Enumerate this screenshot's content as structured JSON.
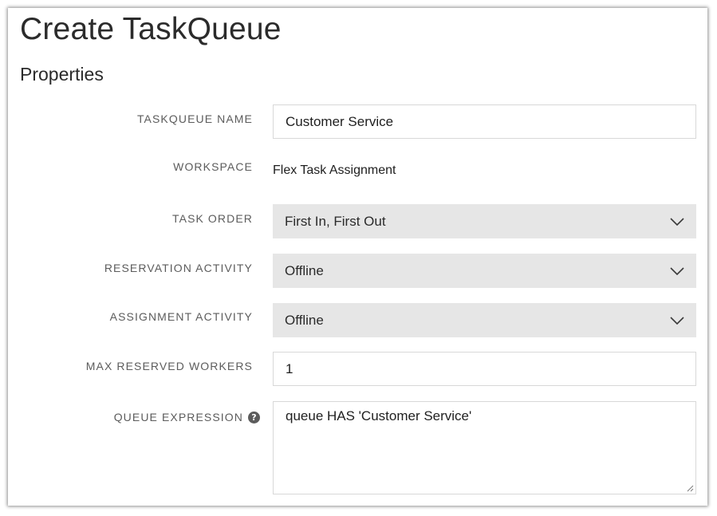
{
  "page": {
    "title": "Create TaskQueue",
    "section_title": "Properties"
  },
  "form": {
    "taskqueue_name": {
      "label": "TASKQUEUE NAME",
      "value": "Customer Service"
    },
    "workspace": {
      "label": "WORKSPACE",
      "value": "Flex Task Assignment"
    },
    "task_order": {
      "label": "TASK ORDER",
      "selected": "First In, First Out"
    },
    "reservation_activity": {
      "label": "RESERVATION ACTIVITY",
      "selected": "Offline"
    },
    "assignment_activity": {
      "label": "ASSIGNMENT ACTIVITY",
      "selected": "Offline"
    },
    "max_reserved_workers": {
      "label": "MAX RESERVED WORKERS",
      "value": "1"
    },
    "queue_expression": {
      "label": "QUEUE EXPRESSION",
      "value": "queue HAS 'Customer Service'",
      "help_icon": "question-circle-icon"
    }
  },
  "icons": {
    "dropdown": "chevron-down-icon",
    "resize": "resize-grip-icon"
  },
  "colors": {
    "select_bg": "#e6e6e6",
    "label_text": "#5c5c5c",
    "input_border": "#d8d8d8"
  }
}
